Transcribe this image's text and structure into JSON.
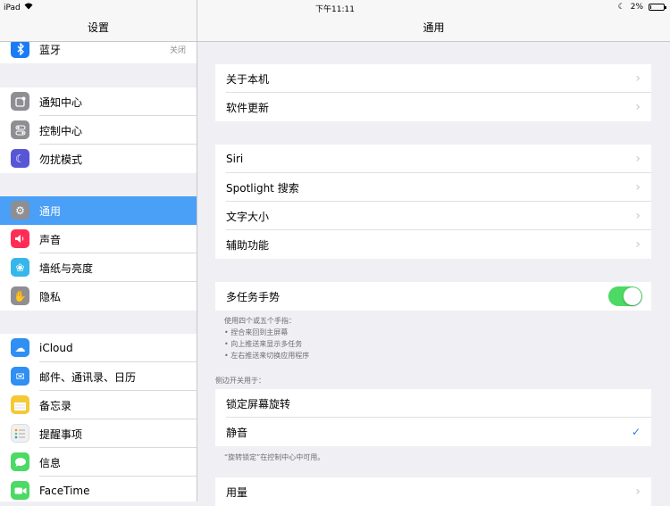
{
  "status_bar": {
    "device": "iPad",
    "time": "下午11:11",
    "battery": "2%"
  },
  "left": {
    "title": "设置",
    "items": [
      {
        "label": "蓝牙",
        "value": "关闭",
        "icon": "bluetooth-icon",
        "color": "#1a7cf4"
      },
      {
        "label": "通知中心",
        "icon": "notification-center-icon",
        "color": "#8e8e93"
      },
      {
        "label": "控制中心",
        "icon": "control-center-icon",
        "color": "#8e8e93"
      },
      {
        "label": "勿扰模式",
        "icon": "moon-icon",
        "color": "#5856d6"
      },
      {
        "label": "通用",
        "icon": "gear-icon",
        "color": "#8e8e93",
        "selected": true
      },
      {
        "label": "声音",
        "icon": "speaker-icon",
        "color": "#ff2d55"
      },
      {
        "label": "墙纸与亮度",
        "icon": "wallpaper-icon",
        "color": "#36b6ea"
      },
      {
        "label": "隐私",
        "icon": "hand-icon",
        "color": "#8e8e93"
      },
      {
        "label": "iCloud",
        "icon": "cloud-icon",
        "color": "#2f8ff3"
      },
      {
        "label": "邮件、通讯录、日历",
        "icon": "mail-icon",
        "color": "#2f8ff3"
      },
      {
        "label": "备忘录",
        "icon": "notes-icon",
        "color": "#f5c935"
      },
      {
        "label": "提醒事项",
        "icon": "reminders-icon",
        "color": "#f0f0f0"
      },
      {
        "label": "信息",
        "icon": "messages-icon",
        "color": "#4cd964"
      },
      {
        "label": "FaceTime",
        "icon": "facetime-icon",
        "color": "#4cd964"
      }
    ]
  },
  "right": {
    "title": "通用",
    "group1": [
      "关于本机",
      "软件更新"
    ],
    "group2": [
      "Siri",
      "Spotlight 搜索",
      "文字大小",
      "辅助功能"
    ],
    "multitask": {
      "label": "多任务手势",
      "on": true
    },
    "multitask_footer": [
      "使用四个或五个手指：",
      "• 捏合来回到主屏幕",
      "• 向上推送来显示多任务",
      "• 左右推送来切换应用程序"
    ],
    "side_switch_header": "侧边开关用于：",
    "side_switch": [
      {
        "label": "锁定屏幕旋转",
        "checked": false
      },
      {
        "label": "静音",
        "checked": true
      }
    ],
    "side_switch_footer": "“旋转锁定”在控制中心中可用。",
    "group5": [
      "用量"
    ]
  },
  "accent_color": "#4a9ff7"
}
